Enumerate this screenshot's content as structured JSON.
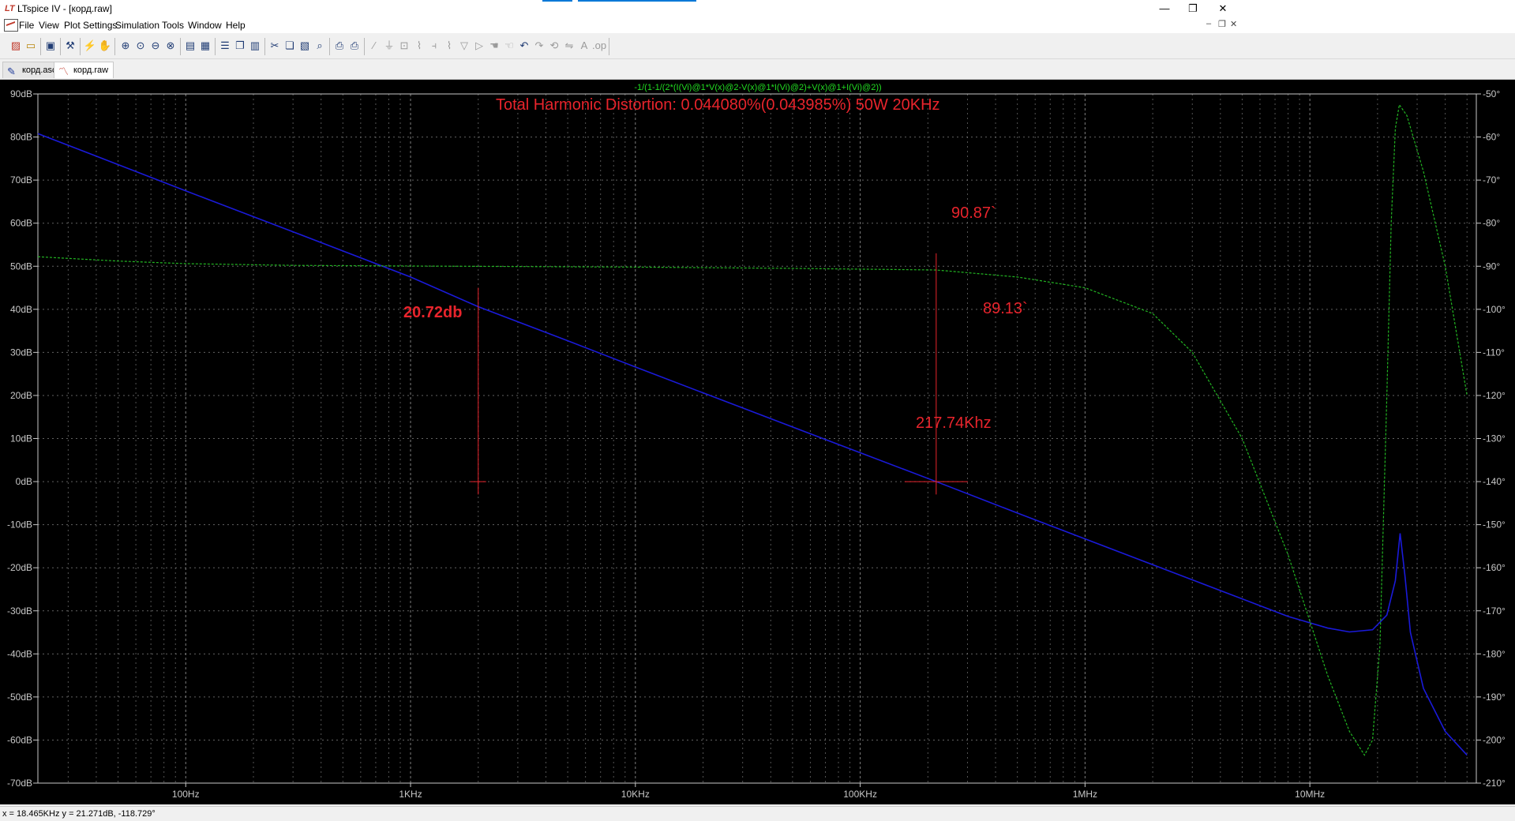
{
  "window": {
    "title": "LTspice IV - [корд.raw]",
    "app_icon": "ltspice-logo-icon",
    "controls": [
      "—",
      "❐",
      "✕"
    ]
  },
  "menu": {
    "items": [
      "File",
      "View",
      "Plot Settings",
      "Simulation",
      "Tools",
      "Window",
      "Help"
    ],
    "mdi_controls": [
      "–",
      "❐",
      "✕"
    ]
  },
  "tabs": [
    {
      "label": "корд.asc",
      "icon": "schematic-icon",
      "active": false
    },
    {
      "label": "корд.raw",
      "icon": "waveform-icon",
      "active": true
    }
  ],
  "plot": {
    "trace_expression": "-1/(1-1/(2*(I(Vi)@1*V(x)@2-V(x)@1*I(Vi)@2)+V(x)@1+I(Vi)@2))",
    "colors": {
      "background": "#000000",
      "grid": "#8c8c8c",
      "magnitude": "#1a1ad9",
      "phase": "#22b522",
      "expression": "#22dd22",
      "annotation": "#e8242c",
      "axis_labels": "#c8c8c8"
    },
    "annotations": {
      "thd": "Total Harmonic Distortion: 0.044080%(0.043985%)   50W 20KHz",
      "phase_at_crossover": "90.87`",
      "phase_margin": "89.13`",
      "gain_margin": "20.72db",
      "crossover_freq": "217.74Khz"
    }
  },
  "chart_data": {
    "type": "line",
    "xscale": "log",
    "xlim": [
      22,
      55000000
    ],
    "x_ticks": [
      "100Hz",
      "1KHz",
      "10KHz",
      "100KHz",
      "1MHz",
      "10MHz"
    ],
    "y_left_label_ticks": [
      "90dB",
      "80dB",
      "70dB",
      "60dB",
      "50dB",
      "40dB",
      "30dB",
      "20dB",
      "10dB",
      "0dB",
      "-10dB",
      "-20dB",
      "-30dB",
      "-40dB",
      "-50dB",
      "-60dB",
      "-70dB"
    ],
    "y_right_label_ticks": [
      "-50°",
      "-60°",
      "-70°",
      "-80°",
      "-90°",
      "-100°",
      "-110°",
      "-120°",
      "-130°",
      "-140°",
      "-150°",
      "-160°",
      "-170°",
      "-180°",
      "-190°",
      "-200°",
      "-210°"
    ],
    "ylim_db": [
      -70,
      90
    ],
    "ylim_deg": [
      -210,
      -50
    ],
    "grid": true,
    "series": [
      {
        "axis": "db",
        "points": [
          [
            22,
            80.8
          ],
          [
            50,
            73.6
          ],
          [
            100,
            67.5
          ],
          [
            300,
            58.0
          ],
          [
            1000,
            47.5
          ],
          [
            2000,
            40.6
          ],
          [
            5000,
            32.7
          ],
          [
            10000,
            26.6
          ],
          [
            30000,
            17.1
          ],
          [
            100000,
            6.7
          ],
          [
            217740,
            0
          ],
          [
            500000,
            -7.3
          ],
          [
            1000000,
            -13.3
          ],
          [
            3000000,
            -22.8
          ],
          [
            8000000,
            -31.3
          ],
          [
            12000000,
            -34.0
          ],
          [
            15000000,
            -34.9
          ],
          [
            19000000,
            -34.4
          ],
          [
            22000000,
            -31.0
          ],
          [
            24000000,
            -23.0
          ],
          [
            25200000,
            -12.0
          ],
          [
            26500000,
            -22.0
          ],
          [
            28000000,
            -35.0
          ],
          [
            32000000,
            -48.0
          ],
          [
            40000000,
            -58.0
          ],
          [
            50000000,
            -63.5
          ]
        ]
      },
      {
        "axis": "deg",
        "points": [
          [
            22,
            -87.8
          ],
          [
            50,
            -88.8
          ],
          [
            100,
            -89.4
          ],
          [
            300,
            -89.8
          ],
          [
            1000,
            -89.95
          ],
          [
            10000,
            -90.2
          ],
          [
            50000,
            -90.5
          ],
          [
            217740,
            -90.87
          ],
          [
            500000,
            -92.5
          ],
          [
            1000000,
            -95.0
          ],
          [
            2000000,
            -101.0
          ],
          [
            3000000,
            -110.0
          ],
          [
            5000000,
            -130.0
          ],
          [
            8000000,
            -157.0
          ],
          [
            12000000,
            -185.0
          ],
          [
            15000000,
            -198.0
          ],
          [
            17500000,
            -203.5
          ],
          [
            19000000,
            -200.0
          ],
          [
            20500000,
            -178.0
          ],
          [
            22000000,
            -120.0
          ],
          [
            23000000,
            -80.0
          ],
          [
            24000000,
            -58.0
          ],
          [
            25000000,
            -52.5
          ],
          [
            27000000,
            -55.0
          ],
          [
            32000000,
            -68.0
          ],
          [
            40000000,
            -90.0
          ],
          [
            50000000,
            -120.0
          ]
        ]
      }
    ]
  },
  "status": {
    "readout": "x = 18.465KHz   y = 21.271dB, -118.729°"
  }
}
